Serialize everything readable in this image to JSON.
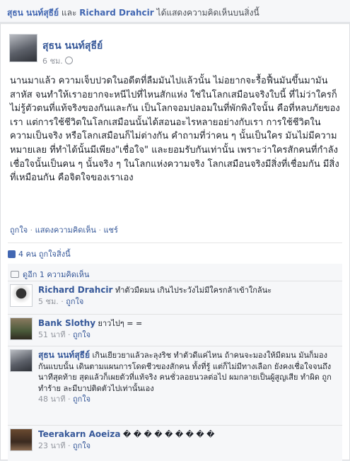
{
  "header": {
    "user1": "สุธน นนท์สุธีย์",
    "conj": "และ",
    "user2": "Richard Drahcir",
    "action": "ได้แสดงความคิดเห็นบนสิ่งนี้"
  },
  "post": {
    "author": "สุธน นนท์สุธีย์",
    "time": "6 ชม.",
    "text": "นานมาแล้ว ความเจ็บปวดในอดีตที่ลืมมันไปแล้วนั้น ไม่อยากจะรื้อฟื้นมันขึ้นมามันสาหัส จนทำให้เราอยากจะหนีไปที่ไหนสักแห่ง ใช่ในโลกเสมือนจริงใบนี้ ที่ไม่ว่าใครก็ไม่รู้ตัวตนที่แท้จริงของกันและกัน เป็นโลกจอมปลอมในที่พักพิงใจนั้น คือที่หลบภัยของเรา แต่การใช้ชีวิตในโลกเสมือนนั้นได้สอนอะไรหลายอย่างกับเรา การใช้ชีวิตในความเป็นจริง หรือโลกเสมือนก็ไม่ต่างกัน คำถามที่ว่าคน ๆ นั้นเป็นใคร มันไม่มีความหมายเลย ที่ทำได้นั้นมีเพียง\"เชื่อใจ\" และยอมรับกันเท่านั้น เพราะว่าใครสักคนที่กำลังเชื่อใจนั้นเป็นคน ๆ นั้นจริง ๆ ในโลกแห่งความจริง โลกเสมือนจริงมีสิ่งที่เชื่อมกัน มีสิ่งที่เหมือนกัน คือจิตใจของเราเอง",
    "actions": {
      "like": "ถูกใจ",
      "sep1": " · ",
      "comment": "แสดงความคิดเห็น",
      "sep2": " · ",
      "share": "แชร์"
    }
  },
  "likes": {
    "count_text": "4 คน ถูกใจสิ่งนี้"
  },
  "comments_header": {
    "text": "ดูอีก 1 ความคิดเห็น"
  },
  "comments": [
    {
      "author": "Richard Drahcir",
      "text": "ทำตัวมืดมน เกินไประวังไม่มีใครกล้าเข้าใกล้นะ",
      "time": "5 ชม.",
      "sep": " · ",
      "like": "ถูกใจ"
    },
    {
      "author": "Bank Slothy",
      "text": "ยาวไปๆ = =",
      "time": "51 นาที",
      "sep": " · ",
      "like": "ถูกใจ"
    },
    {
      "author": "สุธน นนท์สุธีย์",
      "text": "เกินเยียวยาแล้วละลุงริช ทำตัวดีแค่ไหน ถ้าคนจะมองให้มีดมน มันก็มองกันแบบนั้น เดินตามแผนการโดดชีวของสักคน ทั้งที่รู้ แต่ก็ไม่มีทางเลือก ยังคงเชื่อใจจนถึงนาทีสุดท้าย สุดแล้วก็เผยตัวที่แท้จริง คนชั่วลอยนวลต่อไป ผมกลายเป็นผู้สูญเสีย ทำผิด ถูกทำร้าย ละมีบาปติดตัวไปเท่านั้นเอง",
      "time": "48 นาที",
      "sep": " · ",
      "like": "ถูกใจ"
    },
    {
      "author": "Teerakarn Aoeiza",
      "text": "� � � � � � � � �",
      "time": "23 นาที",
      "sep": " · ",
      "like": "ถูกใจ"
    }
  ],
  "colors": {
    "link": "#365899",
    "bg": "#e9ebee",
    "comment_bg": "#f6f7f9"
  }
}
